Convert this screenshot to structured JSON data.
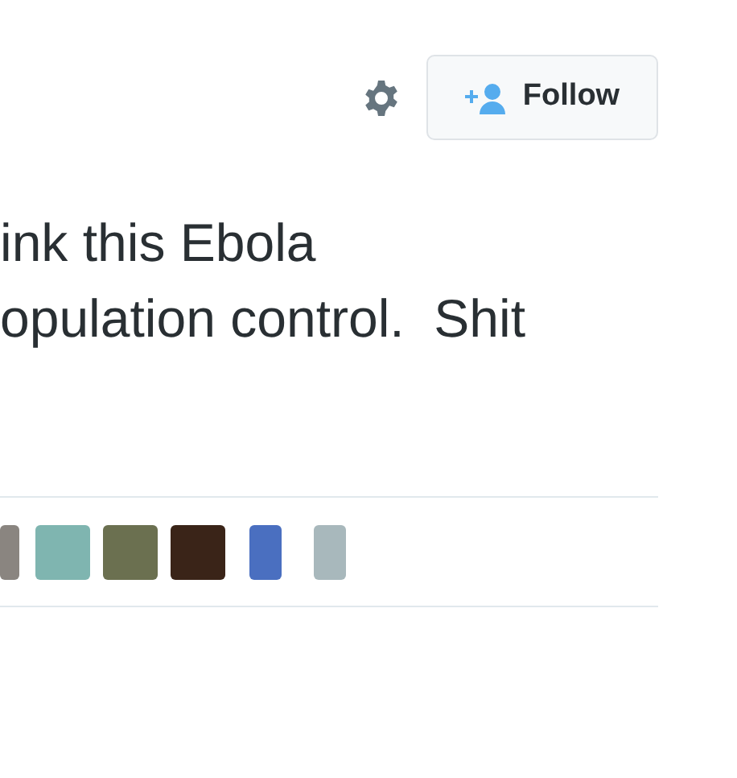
{
  "follow_button": {
    "label": "Follow"
  },
  "tweet_text": [
    "ink this Ebola",
    "opulation control.  Shit"
  ]
}
